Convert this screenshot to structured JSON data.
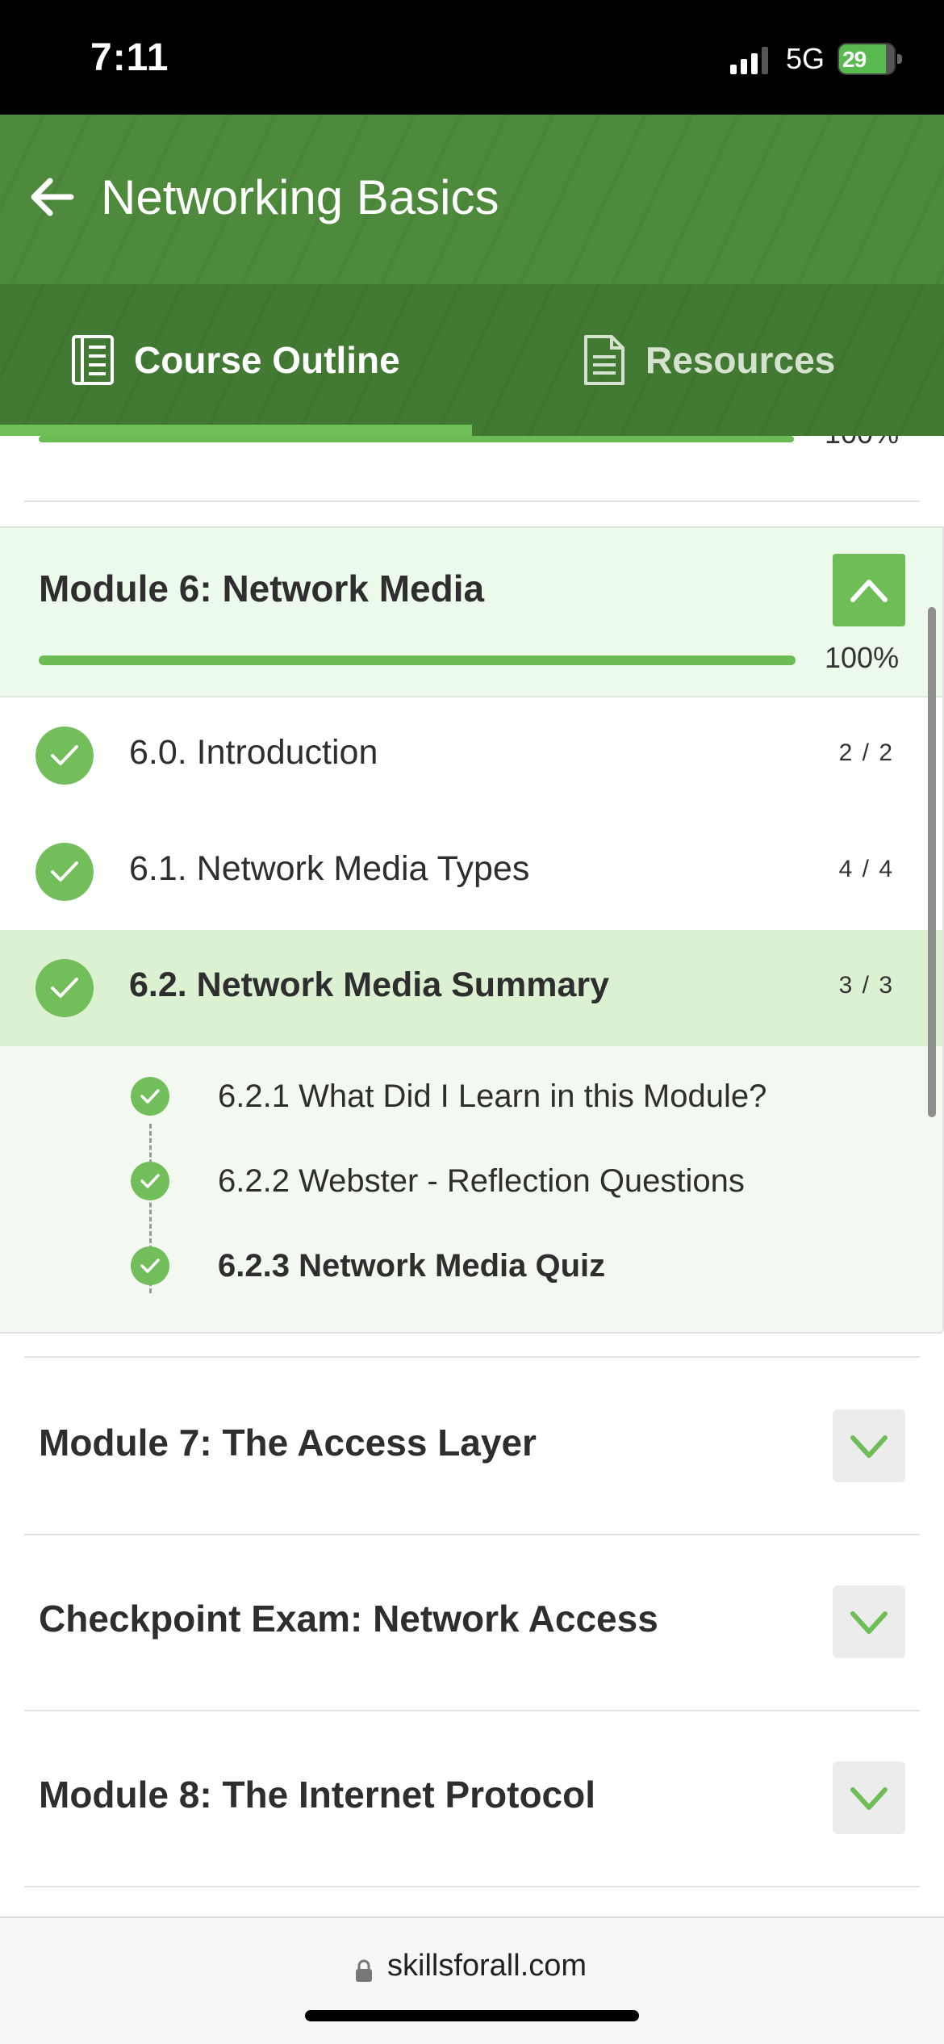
{
  "status_bar": {
    "time": "7:11",
    "network": "5G",
    "battery": "29"
  },
  "header": {
    "title": "Networking Basics"
  },
  "tabs": [
    {
      "label": "Course Outline",
      "icon": "book-icon",
      "selected": true
    },
    {
      "label": "Resources",
      "icon": "document-icon",
      "selected": false
    }
  ],
  "previous_module": {
    "progress_text": "100%",
    "progress": 1.0
  },
  "module6": {
    "title": "Module 6: Network Media",
    "progress_text": "100%",
    "progress": 1.0,
    "sections": [
      {
        "label": "6.0. Introduction",
        "count": "2 / 2",
        "completed": true
      },
      {
        "label": "6.1. Network Media Types",
        "count": "4 / 4",
        "completed": true
      },
      {
        "label": "6.2. Network Media Summary",
        "count": "3 / 3",
        "completed": true,
        "active": true
      }
    ],
    "sub_items": [
      {
        "label": "6.2.1 What Did I Learn in this Module?",
        "completed": true
      },
      {
        "label": "6.2.2 Webster - Reflection Questions",
        "completed": true
      },
      {
        "label": "6.2.3 Network Media Quiz",
        "completed": true,
        "current": true
      }
    ]
  },
  "modules": [
    {
      "title": "Module 7: The Access Layer",
      "expanded": false
    },
    {
      "title": "Checkpoint Exam: Network Access",
      "expanded": false
    },
    {
      "title": "Module 8: The Internet Protocol",
      "expanded": false
    }
  ],
  "browser": {
    "url": "skillsforall.com"
  },
  "colors": {
    "brand_green": "#4e8a3c",
    "accent_green": "#6fbd57",
    "active_row": "#dcf0d2"
  }
}
